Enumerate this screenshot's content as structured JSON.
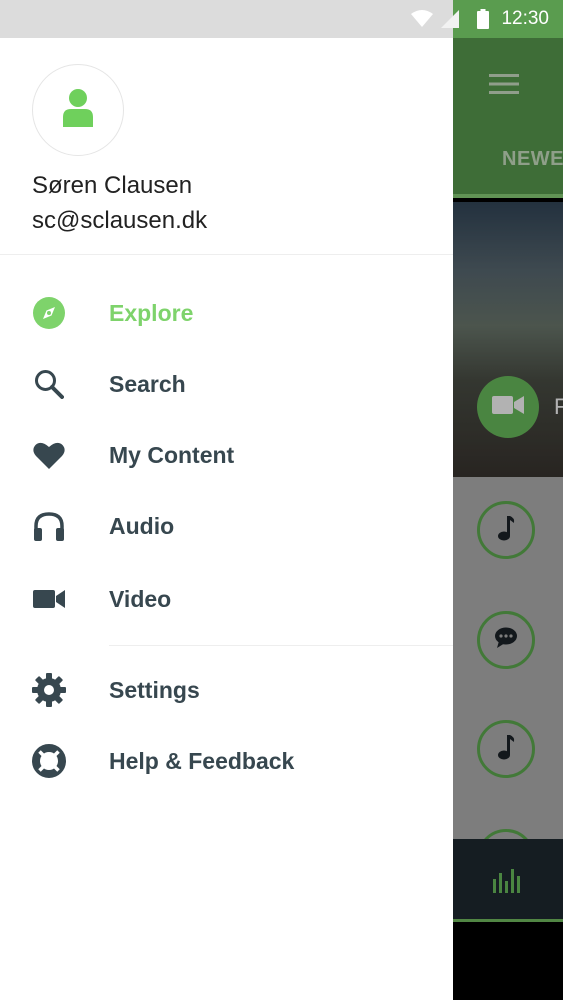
{
  "status_bar": {
    "time": "12:30"
  },
  "user": {
    "name": "Søren Clausen",
    "email": "sc@sclausen.dk"
  },
  "nav": {
    "items": [
      {
        "label": "Explore",
        "icon": "compass-icon",
        "active": true
      },
      {
        "label": "Search",
        "icon": "search-icon"
      },
      {
        "label": "My Content",
        "icon": "heart-icon"
      },
      {
        "label": "Audio",
        "icon": "headphones-icon"
      },
      {
        "label": "Video",
        "icon": "video-camera-icon"
      }
    ],
    "secondary": [
      {
        "label": "Settings",
        "icon": "gear-icon"
      },
      {
        "label": "Help & Feedback",
        "icon": "lifebuoy-icon"
      }
    ]
  },
  "background_app": {
    "tab_label": "NEWE",
    "hero_text": "F"
  },
  "colors": {
    "accent": "#7ed36b",
    "toolbar": "#5a9c4f",
    "icon": "#37474f"
  }
}
